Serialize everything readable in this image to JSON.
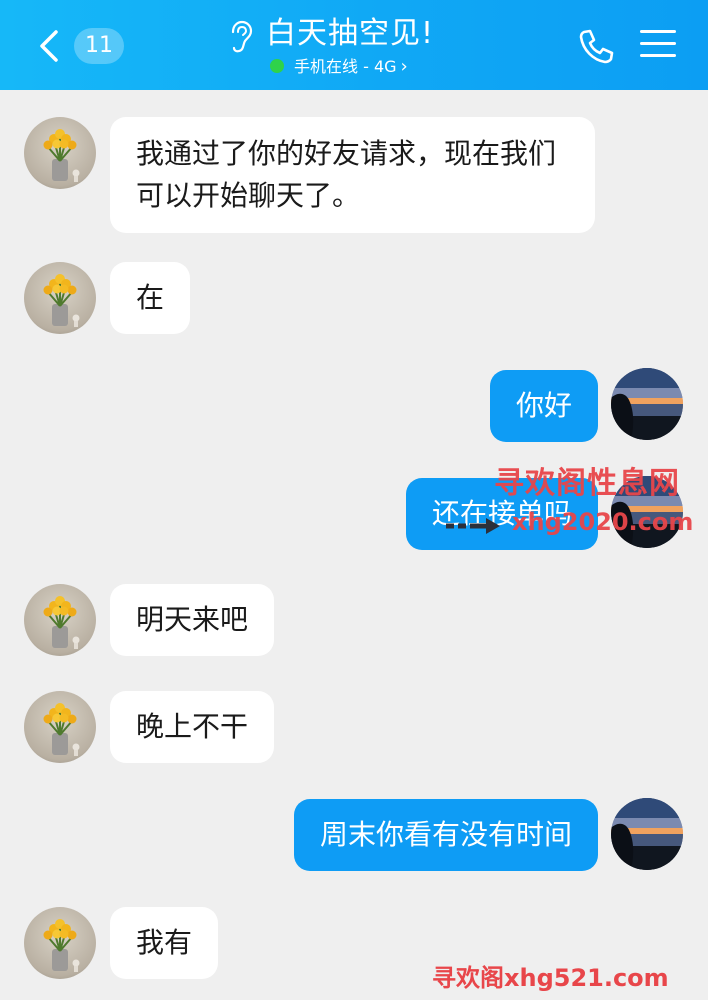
{
  "header": {
    "unread_count": "11",
    "title": "白天抽空见!",
    "status": "手机在线 - 4G",
    "status_chevron": "›",
    "bg_color": "#12aef6",
    "online_color": "#2fd24a"
  },
  "messages": [
    {
      "side": "left",
      "text": "我通过了你的好友请求，现在我们可以开始聊天了。"
    },
    {
      "side": "left",
      "text": "在"
    },
    {
      "side": "right",
      "text": "你好"
    },
    {
      "side": "right",
      "text": "还在接单吗"
    },
    {
      "side": "left",
      "text": "明天来吧"
    },
    {
      "side": "left",
      "text": "晚上不干"
    },
    {
      "side": "right",
      "text": "周末你看有没有时间"
    },
    {
      "side": "left",
      "text": "我有"
    }
  ],
  "watermark": {
    "line1": "寻欢阁性息网",
    "line2": "xhg2020.com",
    "line3": "寻欢阁xhg521.com",
    "color": "#e8464a"
  },
  "colors": {
    "left_bubble": "#ffffff",
    "right_bubble": "#0e9cf5",
    "background": "#efefef"
  }
}
